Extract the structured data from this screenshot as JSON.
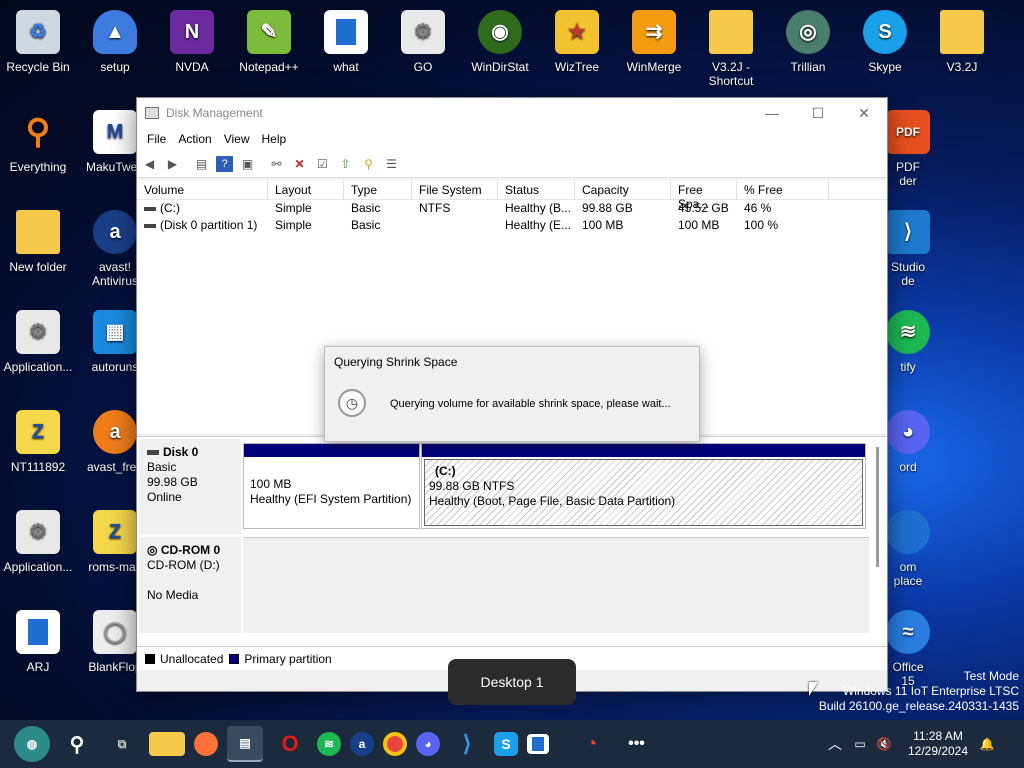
{
  "desktop_icons": [
    {
      "label": "Recycle Bin",
      "icon": "recycle-bin-icon"
    },
    {
      "label": "setup",
      "icon": "setup-icon"
    },
    {
      "label": "NVDA",
      "icon": "nvda-icon"
    },
    {
      "label": "Notepad++",
      "icon": "notepadpp-icon"
    },
    {
      "label": "what",
      "icon": "app-icon"
    },
    {
      "label": "GO",
      "icon": "gears-icon"
    },
    {
      "label": "WinDirStat",
      "icon": "windirstat-icon"
    },
    {
      "label": "WizTree",
      "icon": "wiztree-icon"
    },
    {
      "label": "WinMerge",
      "icon": "winmerge-icon"
    },
    {
      "label": "V3.2J -",
      "label2": "Shortcut",
      "icon": "folder-icon"
    },
    {
      "label": "Trillian",
      "icon": "trillian-icon"
    },
    {
      "label": "Skype",
      "icon": "skype-icon"
    },
    {
      "label": "V3.2J",
      "icon": "folder-icon"
    },
    {
      "label": "Everything",
      "icon": "everything-icon"
    },
    {
      "label": "MakuTwea",
      "icon": "makutweaker-icon"
    },
    {
      "label": "New folder",
      "icon": "folder-icon"
    },
    {
      "label": "avast!",
      "label2": "Antivirus",
      "icon": "avast-icon"
    },
    {
      "label": "Application...",
      "icon": "gears-icon"
    },
    {
      "label": "autoruns",
      "icon": "autoruns-icon"
    },
    {
      "label": "NT111892",
      "icon": "zip-folder-icon"
    },
    {
      "label": "avast_free",
      "icon": "avast-icon"
    },
    {
      "label": "Application...",
      "icon": "gears-icon"
    },
    {
      "label": "roms-mas",
      "icon": "zip-folder-icon"
    },
    {
      "label": "ARJ",
      "icon": "app-icon"
    },
    {
      "label": "BlankFlop",
      "icon": "disk-icon"
    },
    {
      "label": "PDF",
      "label2": "der",
      "icon": "pdf-icon"
    },
    {
      "label": "Studio",
      "label2": "de",
      "icon": "vscode-icon"
    },
    {
      "label": "tify",
      "icon": "spotify-icon"
    },
    {
      "label": "ord",
      "icon": "discord-icon"
    },
    {
      "label": "om",
      "label2": "place",
      "icon": "app-icon"
    },
    {
      "label": "Office",
      "label2": "15",
      "icon": "office-icon"
    }
  ],
  "window": {
    "title": "Disk Management",
    "menu": [
      "File",
      "Action",
      "View",
      "Help"
    ],
    "columns": [
      "Volume",
      "Layout",
      "Type",
      "File System",
      "Status",
      "Capacity",
      "Free Spa...",
      "% Free"
    ],
    "rows": [
      [
        "(C:)",
        "Simple",
        "Basic",
        "NTFS",
        "Healthy (B...",
        "99.88 GB",
        "45.52 GB",
        "46 %"
      ],
      [
        "(Disk 0 partition 1)",
        "Simple",
        "Basic",
        "",
        "Healthy (E...",
        "100 MB",
        "100 MB",
        "100 %"
      ]
    ],
    "disk0": {
      "name": "Disk 0",
      "type": "Basic",
      "size": "99.98 GB",
      "state": "Online",
      "partition1": {
        "size": "100 MB",
        "desc": "Healthy (EFI System Partition)"
      },
      "partition2": {
        "name": "(C:)",
        "size": "99.88 GB NTFS",
        "desc": "Healthy (Boot, Page File, Basic Data Partition)"
      }
    },
    "cdrom": {
      "name": "CD-ROM 0",
      "drive": "CD-ROM (D:)",
      "media": "No Media"
    },
    "legend": {
      "unallocated": "Unallocated",
      "primary": "Primary partition"
    }
  },
  "dialog": {
    "title": "Querying Shrink Space",
    "message": "Querying volume for available shrink space, please wait..."
  },
  "tooltip": "Desktop 1",
  "watermark": {
    "line1": "Test Mode",
    "line2": "Windows 11 IoT Enterprise LTSC",
    "line3": "Build 26100.ge_release.240331-1435"
  },
  "tray": {
    "time": "11:28 AM",
    "date": "12/29/2024"
  },
  "colors": {
    "primary_partition": "#00007b",
    "unallocated": "#000000",
    "taskbar": "#1c2a3d"
  }
}
